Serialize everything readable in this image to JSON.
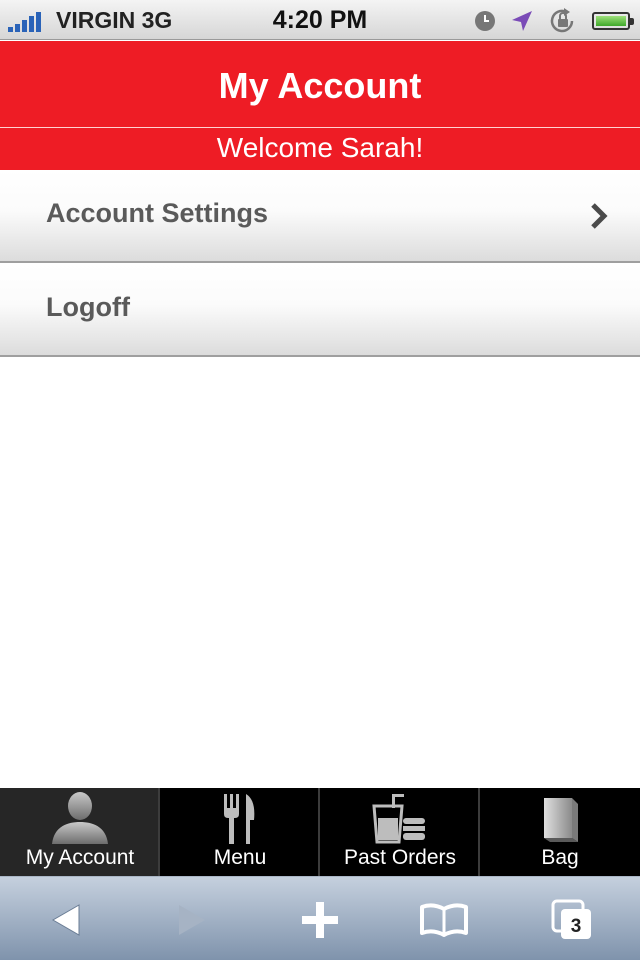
{
  "status_bar": {
    "carrier": "VIRGIN 3G",
    "time": "4:20 PM",
    "icons": [
      "signal-bars-icon",
      "clock-icon",
      "location-arrow-icon",
      "rotation-lock-icon",
      "battery-icon"
    ]
  },
  "header": {
    "title": "My Account",
    "welcome": "Welcome Sarah!"
  },
  "menu": {
    "items": [
      {
        "label": "Account Settings",
        "has_chevron": true
      },
      {
        "label": "Logoff",
        "has_chevron": false
      }
    ]
  },
  "tabbar": {
    "tabs": [
      {
        "label": "My Account",
        "icon": "person-icon",
        "active": true
      },
      {
        "label": "Menu",
        "icon": "fork-knife-icon",
        "active": false
      },
      {
        "label": "Past Orders",
        "icon": "drink-burger-icon",
        "active": false
      },
      {
        "label": "Bag",
        "icon": "shopping-bag-icon",
        "active": false
      }
    ]
  },
  "toolbar": {
    "buttons": [
      "back-arrow-icon",
      "forward-arrow-icon",
      "add-icon",
      "bookmarks-icon",
      "tabs-icon"
    ],
    "tab_count": "3"
  },
  "colors": {
    "header_red": "#ee1c25",
    "tabbar_black": "#000000",
    "toolbar_blue": "#8fa2ba"
  }
}
